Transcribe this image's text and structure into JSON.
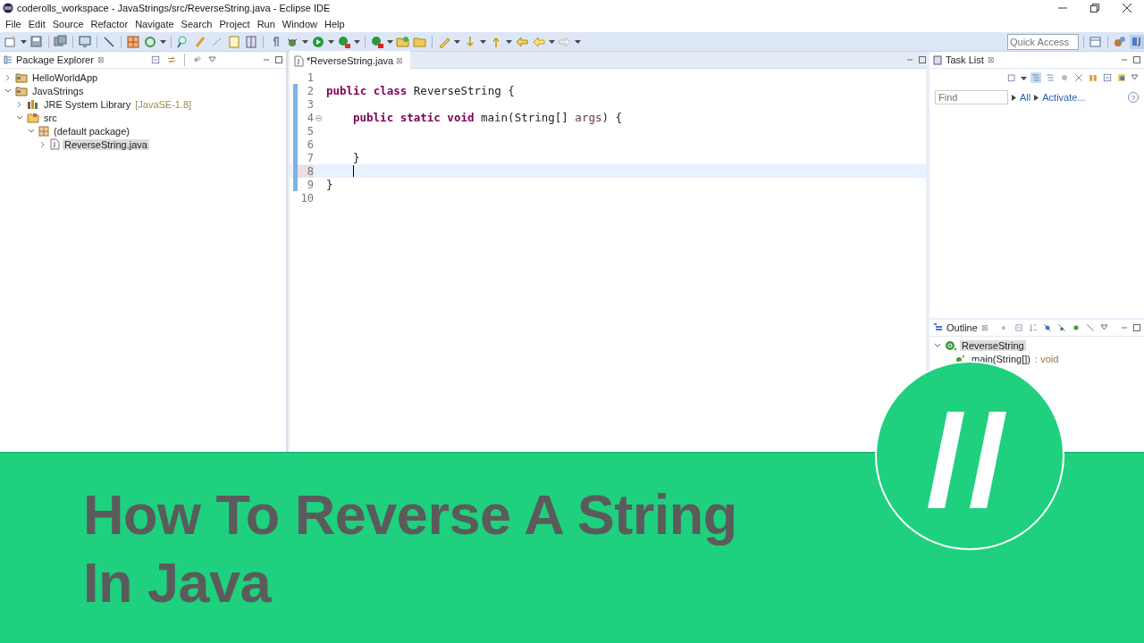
{
  "window": {
    "title": "coderolls_workspace - JavaStrings/src/ReverseString.java - Eclipse IDE"
  },
  "menu": [
    "File",
    "Edit",
    "Source",
    "Refactor",
    "Navigate",
    "Search",
    "Project",
    "Run",
    "Window",
    "Help"
  ],
  "quick_access": {
    "placeholder": "Quick Access"
  },
  "package_explorer": {
    "title": "Package Explorer",
    "close": "⊠",
    "tree": [
      {
        "kind": "project",
        "label": "HelloWorldApp",
        "expanded": false,
        "selected": false
      },
      {
        "kind": "project",
        "label": "JavaStrings",
        "expanded": true,
        "selected": false,
        "children": [
          {
            "kind": "library",
            "label": "JRE System Library",
            "decoration": "[JavaSE-1.8]",
            "expanded": false,
            "selected": false
          },
          {
            "kind": "folder",
            "label": "src",
            "expanded": true,
            "selected": false,
            "children": [
              {
                "kind": "package",
                "label": "(default package)",
                "expanded": true,
                "selected": false,
                "children": [
                  {
                    "kind": "file",
                    "label": "ReverseString.java",
                    "expanded": false,
                    "selected": true
                  }
                ]
              }
            ]
          }
        ]
      }
    ]
  },
  "editor": {
    "tab": {
      "label": "*ReverseString.java",
      "close": "⊠",
      "selected": true
    },
    "lines": [
      {
        "number": "1",
        "changed": false,
        "current": false,
        "foldable": false
      },
      {
        "number": "2",
        "changed": true,
        "current": false,
        "foldable": false,
        "tokens": [
          {
            "kind": "keyword",
            "text": "public class "
          },
          {
            "kind": "plain",
            "text": "ReverseString {"
          }
        ]
      },
      {
        "number": "3",
        "changed": true,
        "current": false,
        "foldable": false
      },
      {
        "number": "4",
        "changed": true,
        "current": false,
        "foldable": true,
        "indented": true,
        "tokens": [
          {
            "kind": "keyword",
            "text": "public static void "
          },
          {
            "kind": "plain",
            "text": "main(String[] "
          },
          {
            "kind": "param",
            "text": "args"
          },
          {
            "kind": "plain",
            "text": ") {"
          }
        ]
      },
      {
        "number": "5",
        "changed": true,
        "current": false,
        "foldable": false
      },
      {
        "number": "6",
        "changed": true,
        "current": false,
        "foldable": false
      },
      {
        "number": "7",
        "changed": true,
        "current": false,
        "foldable": false,
        "indented": true,
        "tokens": [
          {
            "kind": "plain",
            "text": "}"
          }
        ]
      },
      {
        "number": "8",
        "changed": true,
        "current": true,
        "foldable": false,
        "indented": true
      },
      {
        "number": "9",
        "changed": true,
        "current": false,
        "foldable": false,
        "tokens": [
          {
            "kind": "plain",
            "text": "}"
          }
        ]
      },
      {
        "number": "10",
        "changed": false,
        "current": false,
        "foldable": false
      }
    ]
  },
  "task_list": {
    "title": "Task List",
    "close": "⊠",
    "find": {
      "placeholder": "Find"
    },
    "links": [
      "All",
      "Activate..."
    ],
    "help": "?"
  },
  "outline": {
    "title": "Outline",
    "close": "⊠",
    "tree": [
      {
        "kind": "class",
        "label": "ReverseString",
        "expanded": true,
        "selected": true,
        "children": [
          {
            "kind": "method",
            "label": "main(String[])",
            "decoration": ": void",
            "selected": false
          }
        ]
      }
    ]
  },
  "banner": {
    "title_lines": [
      "How To Reverse A String",
      "In Java"
    ]
  }
}
